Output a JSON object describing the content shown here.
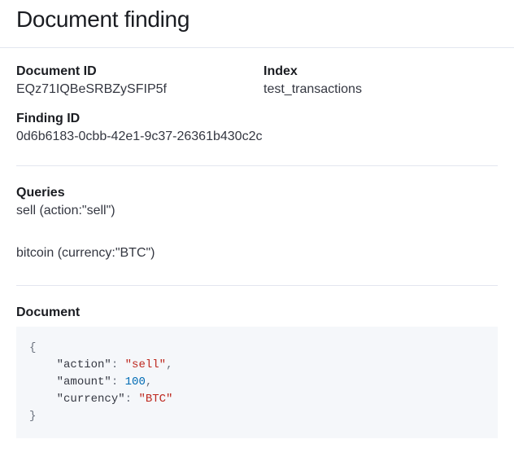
{
  "header": {
    "title": "Document finding"
  },
  "fields": {
    "document_id_label": "Document ID",
    "document_id_value": "EQz71IQBeSRBZySFIP5f",
    "index_label": "Index",
    "index_value": "test_transactions",
    "finding_id_label": "Finding ID",
    "finding_id_value": "0d6b6183-0cbb-42e1-9c37-26361b430c2c"
  },
  "queries": {
    "label": "Queries",
    "items": [
      "sell (action:\"sell\")",
      "bitcoin (currency:\"BTC\")"
    ]
  },
  "document": {
    "label": "Document",
    "json": {
      "action": "sell",
      "amount": 100,
      "currency": "BTC"
    },
    "tokens": {
      "brace_open": "{",
      "brace_close": "}",
      "comma": ",",
      "colon": ": ",
      "k_action": "\"action\"",
      "v_action": "\"sell\"",
      "k_amount": "\"amount\"",
      "v_amount": "100",
      "k_currency": "\"currency\"",
      "v_currency": "\"BTC\""
    }
  }
}
